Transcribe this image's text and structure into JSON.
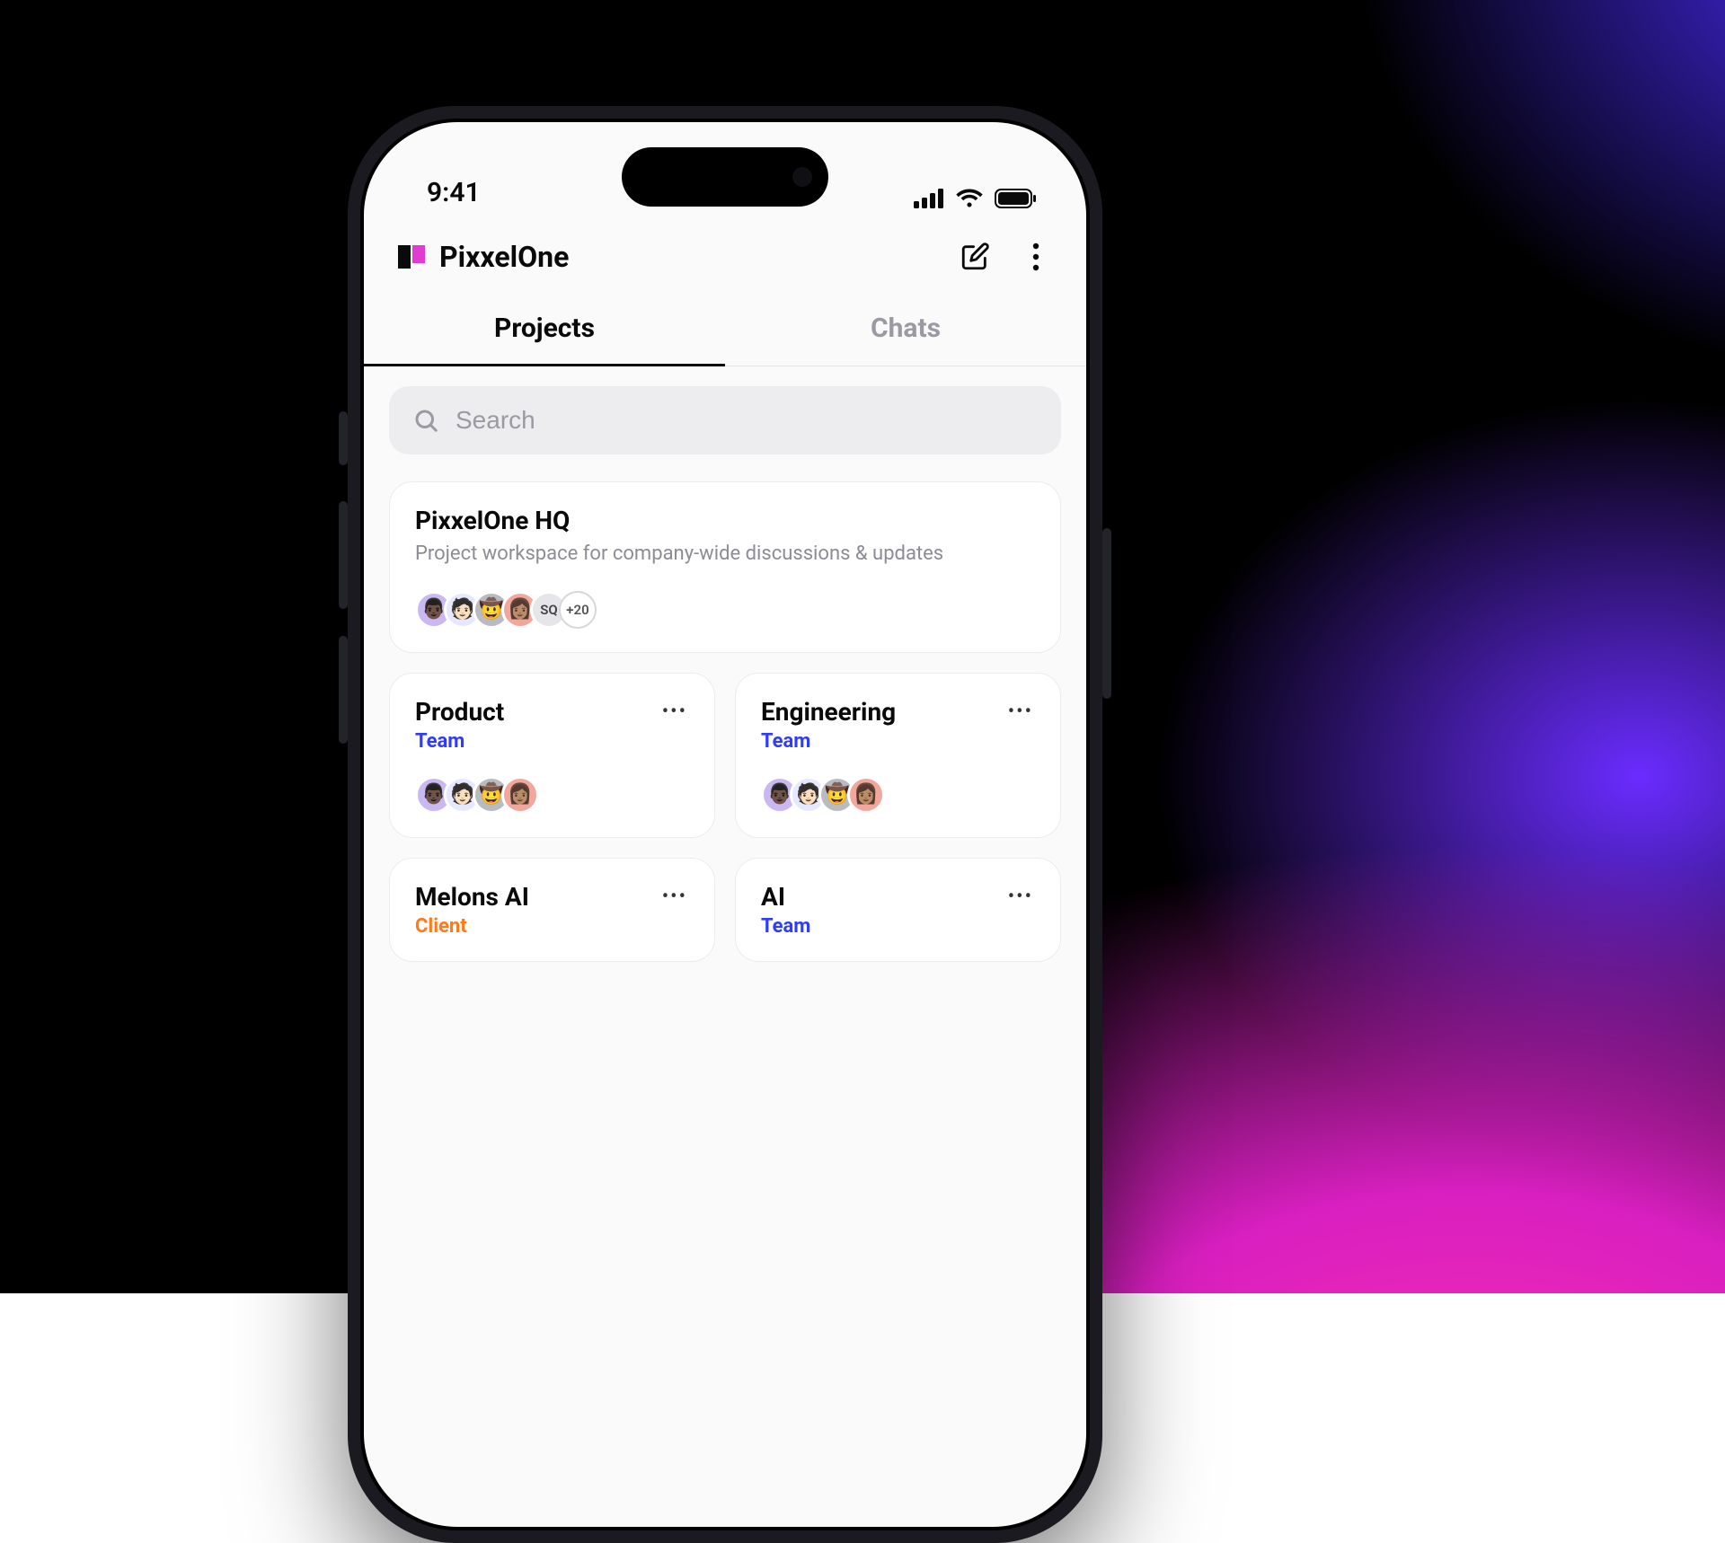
{
  "status": {
    "time": "9:41"
  },
  "header": {
    "brand": "PixxelOne"
  },
  "tabs": {
    "projects": "Projects",
    "chats": "Chats",
    "active": "projects"
  },
  "search": {
    "placeholder": "Search"
  },
  "feature_card": {
    "title": "PixxelOne HQ",
    "subtitle": "Project workspace for company-wide discussions & updates",
    "extra_badge": "SQ",
    "overflow_count": "+20"
  },
  "cards": [
    {
      "title": "Product",
      "tag": "Team",
      "tag_kind": "team"
    },
    {
      "title": "Engineering",
      "tag": "Team",
      "tag_kind": "team"
    },
    {
      "title": "Melons AI",
      "tag": "Client",
      "tag_kind": "client"
    },
    {
      "title": "AI",
      "tag": "Team",
      "tag_kind": "team"
    }
  ],
  "avatar_emojis": [
    "👨🏿",
    "🧑🏻",
    "🤠",
    "👩🏽"
  ]
}
